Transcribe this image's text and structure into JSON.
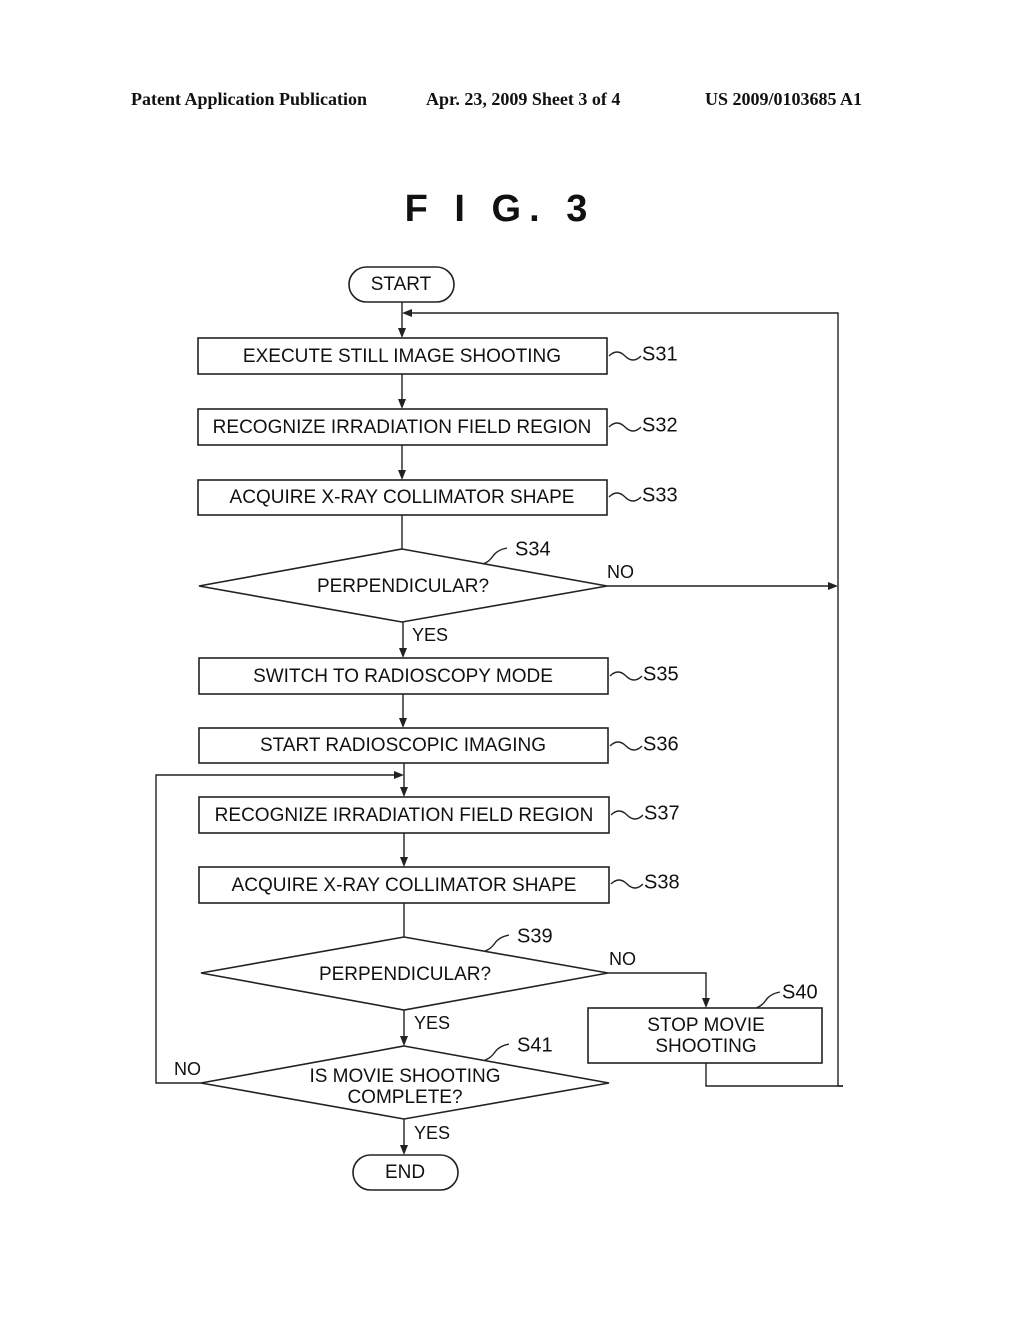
{
  "header": {
    "left": "Patent Application Publication",
    "middle": "Apr. 23, 2009  Sheet 3 of 4",
    "right": "US 2009/0103685 A1"
  },
  "figure": {
    "title": "F I G. 3",
    "start": "START",
    "end": "END",
    "steps": {
      "s31": {
        "id": "S31",
        "text": "EXECUTE STILL IMAGE SHOOTING"
      },
      "s32": {
        "id": "S32",
        "text": "RECOGNIZE IRRADIATION FIELD REGION"
      },
      "s33": {
        "id": "S33",
        "text": "ACQUIRE X-RAY COLLIMATOR SHAPE"
      },
      "s34": {
        "id": "S34",
        "text": "PERPENDICULAR?"
      },
      "s35": {
        "id": "S35",
        "text": "SWITCH TO RADIOSCOPY MODE"
      },
      "s36": {
        "id": "S36",
        "text": "START RADIOSCOPIC IMAGING"
      },
      "s37": {
        "id": "S37",
        "text": "RECOGNIZE IRRADIATION FIELD REGION"
      },
      "s38": {
        "id": "S38",
        "text": "ACQUIRE X-RAY COLLIMATOR SHAPE"
      },
      "s39": {
        "id": "S39",
        "text": "PERPENDICULAR?"
      },
      "s40": {
        "id": "S40",
        "line1": "STOP MOVIE",
        "line2": "SHOOTING"
      },
      "s41": {
        "id": "S41",
        "line1": "IS MOVIE SHOOTING",
        "line2": "COMPLETE?"
      }
    },
    "labels": {
      "yes": "YES",
      "no": "NO"
    }
  }
}
